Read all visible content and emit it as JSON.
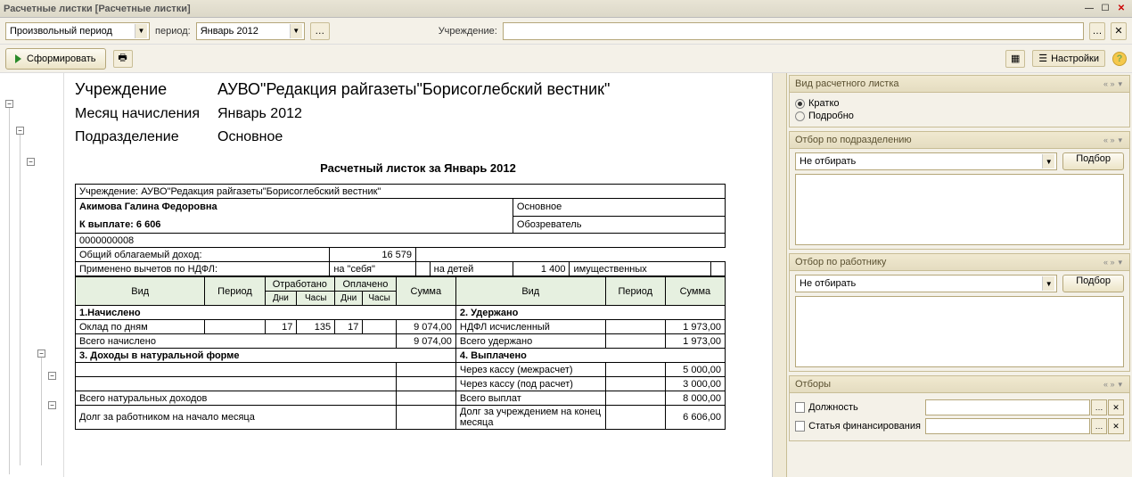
{
  "window": {
    "title": "Расчетные листки [Расчетные листки]"
  },
  "toolbar1": {
    "period_type": "Произвольный период",
    "period_label": "период:",
    "period_value": "Январь 2012",
    "org_label": "Учреждение:"
  },
  "toolbar2": {
    "generate": "Сформировать",
    "settings": "Настройки"
  },
  "header": {
    "org_label": "Учреждение",
    "org_value": "АУВО\"Редакция райгазеты\"Борисоглебский вестник\"",
    "month_label": "Месяц начисления",
    "month_value": "Январь 2012",
    "dept_label": "Подразделение",
    "dept_value": "Основное"
  },
  "doc": {
    "title": "Расчетный листок за Январь 2012",
    "org_line_label": "Учреждение:",
    "org_line_value": "АУВО\"Редакция райгазеты\"Борисоглебский вестник\"",
    "person": "Акимова Галина Федоровна",
    "pay_label": "К выплате: 6 606",
    "dept": "Основное",
    "position": "Обозреватель",
    "tabno": "0000000008",
    "tax_income_label": "Общий облагаемый доход:",
    "tax_income": "16 579",
    "deduct_label": "Применено вычетов по НДФЛ:",
    "deduct_self_label": "на \"себя\"",
    "deduct_self": "",
    "deduct_child_label": "на детей",
    "deduct_child": "1 400",
    "deduct_prop_label": "имущественных",
    "cols": {
      "vid": "Вид",
      "period": "Период",
      "worked": "Отработано",
      "paid": "Оплачено",
      "sum": "Сумма",
      "days": "Дни",
      "hours": "Часы"
    },
    "left": {
      "s1": "1.Начислено",
      "r1_name": "Оклад по дням",
      "r1_d": "17",
      "r1_h": "135",
      "r1_pd": "17",
      "r1_sum": "9 074,00",
      "tot1": "Всего начислено",
      "tot1_sum": "9 074,00",
      "s3": "3. Доходы в натуральной форме",
      "tot3": "Всего натуральных доходов",
      "debt_start": "Долг за работником на начало месяца"
    },
    "right": {
      "s2": "2. Удержано",
      "r1_name": "НДФЛ исчисленный",
      "r1_sum": "1 973,00",
      "tot2": "Всего удержано",
      "tot2_sum": "1 973,00",
      "s4": "4. Выплачено",
      "r4a": "Через кассу (межрасчет)",
      "r4a_sum": "5 000,00",
      "r4b": "Через кассу (под расчет)",
      "r4b_sum": "3 000,00",
      "tot4": "Всего выплат",
      "tot4_sum": "8 000,00",
      "debt_end": "Долг за учреждением на конец месяца",
      "debt_end_sum": "6 606,00"
    }
  },
  "side": {
    "view": {
      "title": "Вид расчетного листка",
      "opt1": "Кратко",
      "opt2": "Подробно"
    },
    "dept": {
      "title": "Отбор по подразделению",
      "value": "Не отбирать",
      "btn": "Подбор"
    },
    "emp": {
      "title": "Отбор по работнику",
      "value": "Не отбирать",
      "btn": "Подбор"
    },
    "filters": {
      "title": "Отборы",
      "f1": "Должность",
      "f2": "Статья финансирования"
    }
  }
}
